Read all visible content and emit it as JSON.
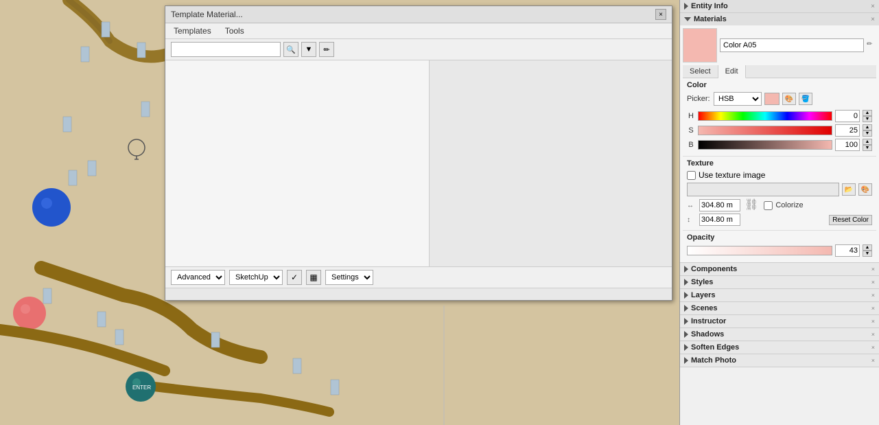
{
  "canvas": {
    "background_color": "#d2c4a0"
  },
  "dialog": {
    "title": "Template Material...",
    "menus": [
      "Templates",
      "Tools"
    ],
    "search_placeholder": "",
    "close_label": "×",
    "footer": {
      "advanced_label": "Advanced",
      "sketchup_label": "SketchUp",
      "settings_label": "Settings"
    }
  },
  "right_panel": {
    "entity_info": {
      "title": "Entity Info",
      "collapsed": true
    },
    "materials": {
      "title": "Materials",
      "expanded": true,
      "material_name": "Color A05",
      "tabs": [
        "Select",
        "Edit"
      ],
      "active_tab": "Edit",
      "color": {
        "label": "Color",
        "picker_label": "Picker:",
        "picker_value": "HSB",
        "h_label": "H",
        "h_value": "0",
        "s_label": "S",
        "s_value": "25",
        "b_label": "B",
        "b_value": "100"
      },
      "texture": {
        "label": "Texture",
        "use_texture_label": "Use texture image",
        "width_value": "304.80 m",
        "height_value": "304.80 m",
        "colorize_label": "Colorize",
        "reset_color_label": "Reset Color"
      },
      "opacity": {
        "label": "Opacity",
        "value": "43"
      }
    },
    "components": {
      "title": "Components",
      "collapsed": true
    },
    "styles": {
      "title": "Styles",
      "collapsed": true
    },
    "layers": {
      "title": "Layers",
      "collapsed": true
    },
    "scenes": {
      "title": "Scenes",
      "collapsed": true
    },
    "instructor": {
      "title": "Instructor",
      "collapsed": true
    },
    "shadows": {
      "title": "Shadows",
      "collapsed": true
    },
    "soften_edges": {
      "title": "Soften Edges",
      "collapsed": true
    },
    "match_photo": {
      "title": "Match Photo",
      "collapsed": true
    }
  }
}
